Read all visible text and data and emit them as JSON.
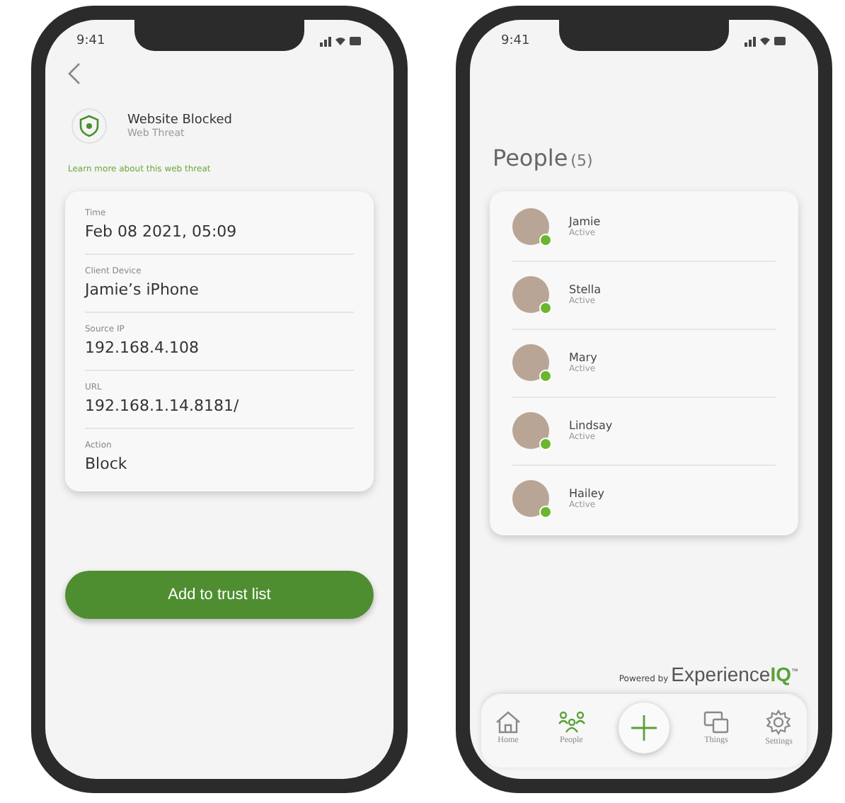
{
  "threat_screen": {
    "status_bar": {
      "time": "9:41"
    },
    "alert": {
      "title": "Website Blocked",
      "subtitle": "Web Threat"
    },
    "learn_more_link": "Learn more about this web threat",
    "details": [
      {
        "label": "Time",
        "value": "Feb 08 2021, 05:09"
      },
      {
        "label": "Client Device",
        "value": "Jamie’s iPhone"
      },
      {
        "label": "Source IP",
        "value": "192.168.4.108"
      },
      {
        "label": "URL",
        "value": "192.168.1.14.8181/"
      },
      {
        "label": "Action",
        "value": "Block"
      }
    ],
    "primary_button": "Add to trust list"
  },
  "people_screen": {
    "status_bar": {
      "time": "9:41"
    },
    "title": "People",
    "count": "(5)",
    "people": [
      {
        "name": "Jamie",
        "status": "Active",
        "online": true
      },
      {
        "name": "Stella",
        "status": "Active",
        "online": true
      },
      {
        "name": "Mary",
        "status": "Active",
        "online": true
      },
      {
        "name": "Lindsay",
        "status": "Active",
        "online": true
      },
      {
        "name": "Hailey",
        "status": "Active",
        "online": true
      }
    ],
    "powered_by": "Powered by",
    "brand": "Experience**IQ**$^{™}$",
    "nav": [
      {
        "kind": "home",
        "label": "Home",
        "selected": false
      },
      {
        "kind": "people",
        "label": "People",
        "selected": true
      },
      {
        "kind": "add",
        "selected": false
      },
      {
        "kind": "things",
        "label": "Things",
        "selected": false
      },
      {
        "kind": "settings",
        "label": "Settings",
        "selected": false
      }
    ]
  }
}
